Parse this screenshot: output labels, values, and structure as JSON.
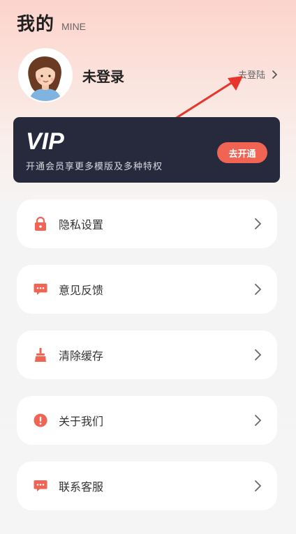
{
  "header": {
    "title": "我的",
    "subtitle": "MINE"
  },
  "profile": {
    "username": "未登录",
    "login_label": "去登陆"
  },
  "vip": {
    "logo_text": "VIP",
    "description": "开通会员享更多模版及多种特权",
    "button_label": "去开通"
  },
  "menu": {
    "items": [
      {
        "label": "隐私设置",
        "icon": "lock-icon"
      },
      {
        "label": "意见反馈",
        "icon": "chat-bubble-icon"
      },
      {
        "label": "清除缓存",
        "icon": "broom-icon"
      },
      {
        "label": "关于我们",
        "icon": "info-circle-icon"
      },
      {
        "label": "联系客服",
        "icon": "message-icon"
      }
    ]
  },
  "colors": {
    "accent": "#f16352",
    "vip_bg": "#262a3c",
    "annotation": "#e8352b"
  }
}
